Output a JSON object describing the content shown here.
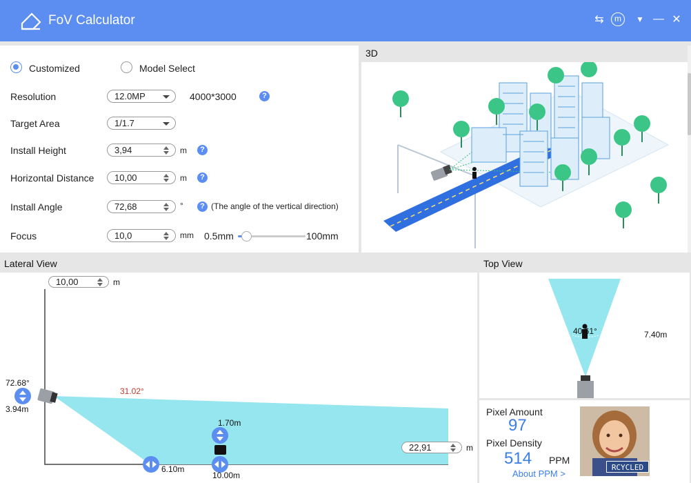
{
  "app": {
    "title": "FoV Calculator"
  },
  "mode": {
    "customized": "Customized",
    "model_select": "Model Select"
  },
  "settings": {
    "resolution": {
      "label": "Resolution",
      "value": "12.0MP",
      "size": "4000*3000"
    },
    "target_area": {
      "label": "Target Area",
      "value": "1/1.7"
    },
    "install_height": {
      "label": "Install Height",
      "value": "3,94",
      "unit": "m"
    },
    "horizontal_distance": {
      "label": "Horizontal Distance",
      "value": "10,00",
      "unit": "m"
    },
    "install_angle": {
      "label": "Install Angle",
      "value": "72,68",
      "unit": "°",
      "note": "(The angle of the vertical direction)"
    },
    "focus": {
      "label": "Focus",
      "value": "10,0",
      "unit": "mm",
      "min": "0.5mm",
      "max": "100mm"
    }
  },
  "panels": {
    "view3d": "3D",
    "lateral": "Lateral View",
    "top": "Top View"
  },
  "lateral": {
    "top_distance": "10,00",
    "top_unit": "m",
    "angle": "72.68°",
    "height": "3.94m",
    "fov_angle": "31.02°",
    "target_height": "1.70m",
    "near_distance": "6.10m",
    "target_distance": "10.00m",
    "far_distance": "22,91",
    "far_unit": "m"
  },
  "top_view": {
    "angle": "40.61°",
    "width": "7.40m"
  },
  "pixels": {
    "amount_label": "Pixel Amount",
    "amount_value": "97",
    "density_label": "Pixel Density",
    "density_value": "514",
    "density_unit": "PPM",
    "about_link": "About PPM >",
    "sample_text": "RCYCLED"
  },
  "icons": {
    "help": "?",
    "swap": "⇆",
    "menu": "m",
    "dropdown": "▼",
    "minimize": "—",
    "close": "✕"
  },
  "colors": {
    "accent": "#5b8ef0",
    "fov": "#95e6ef",
    "fov_angle_text": "#c0392b"
  }
}
